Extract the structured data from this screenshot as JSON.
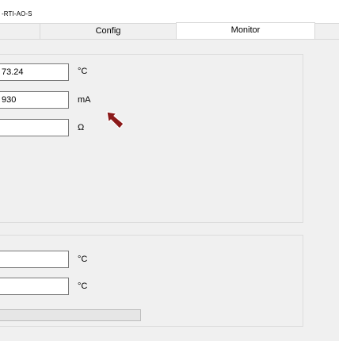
{
  "window": {
    "title": "-RTI-AO-S"
  },
  "tabs": [
    {
      "label": ""
    },
    {
      "label": "Config"
    },
    {
      "label": "Monitor"
    },
    {
      "label": ""
    }
  ],
  "group1": {
    "rows": [
      {
        "value": "73.24",
        "unit": "°C"
      },
      {
        "value": "930",
        "unit": "mA"
      },
      {
        "value": "",
        "unit": "Ω"
      }
    ]
  },
  "group2": {
    "rows": [
      {
        "value": "",
        "unit": "°C"
      },
      {
        "value": "",
        "unit": "°C"
      }
    ],
    "progress": {
      "fraction": 0
    }
  },
  "icons": {
    "cursor": "mouse-pointer-icon"
  },
  "colors": {
    "cursor_fill": "#8b1a1a",
    "panel": "#f0f0f0",
    "border": "#dcdcdc"
  }
}
